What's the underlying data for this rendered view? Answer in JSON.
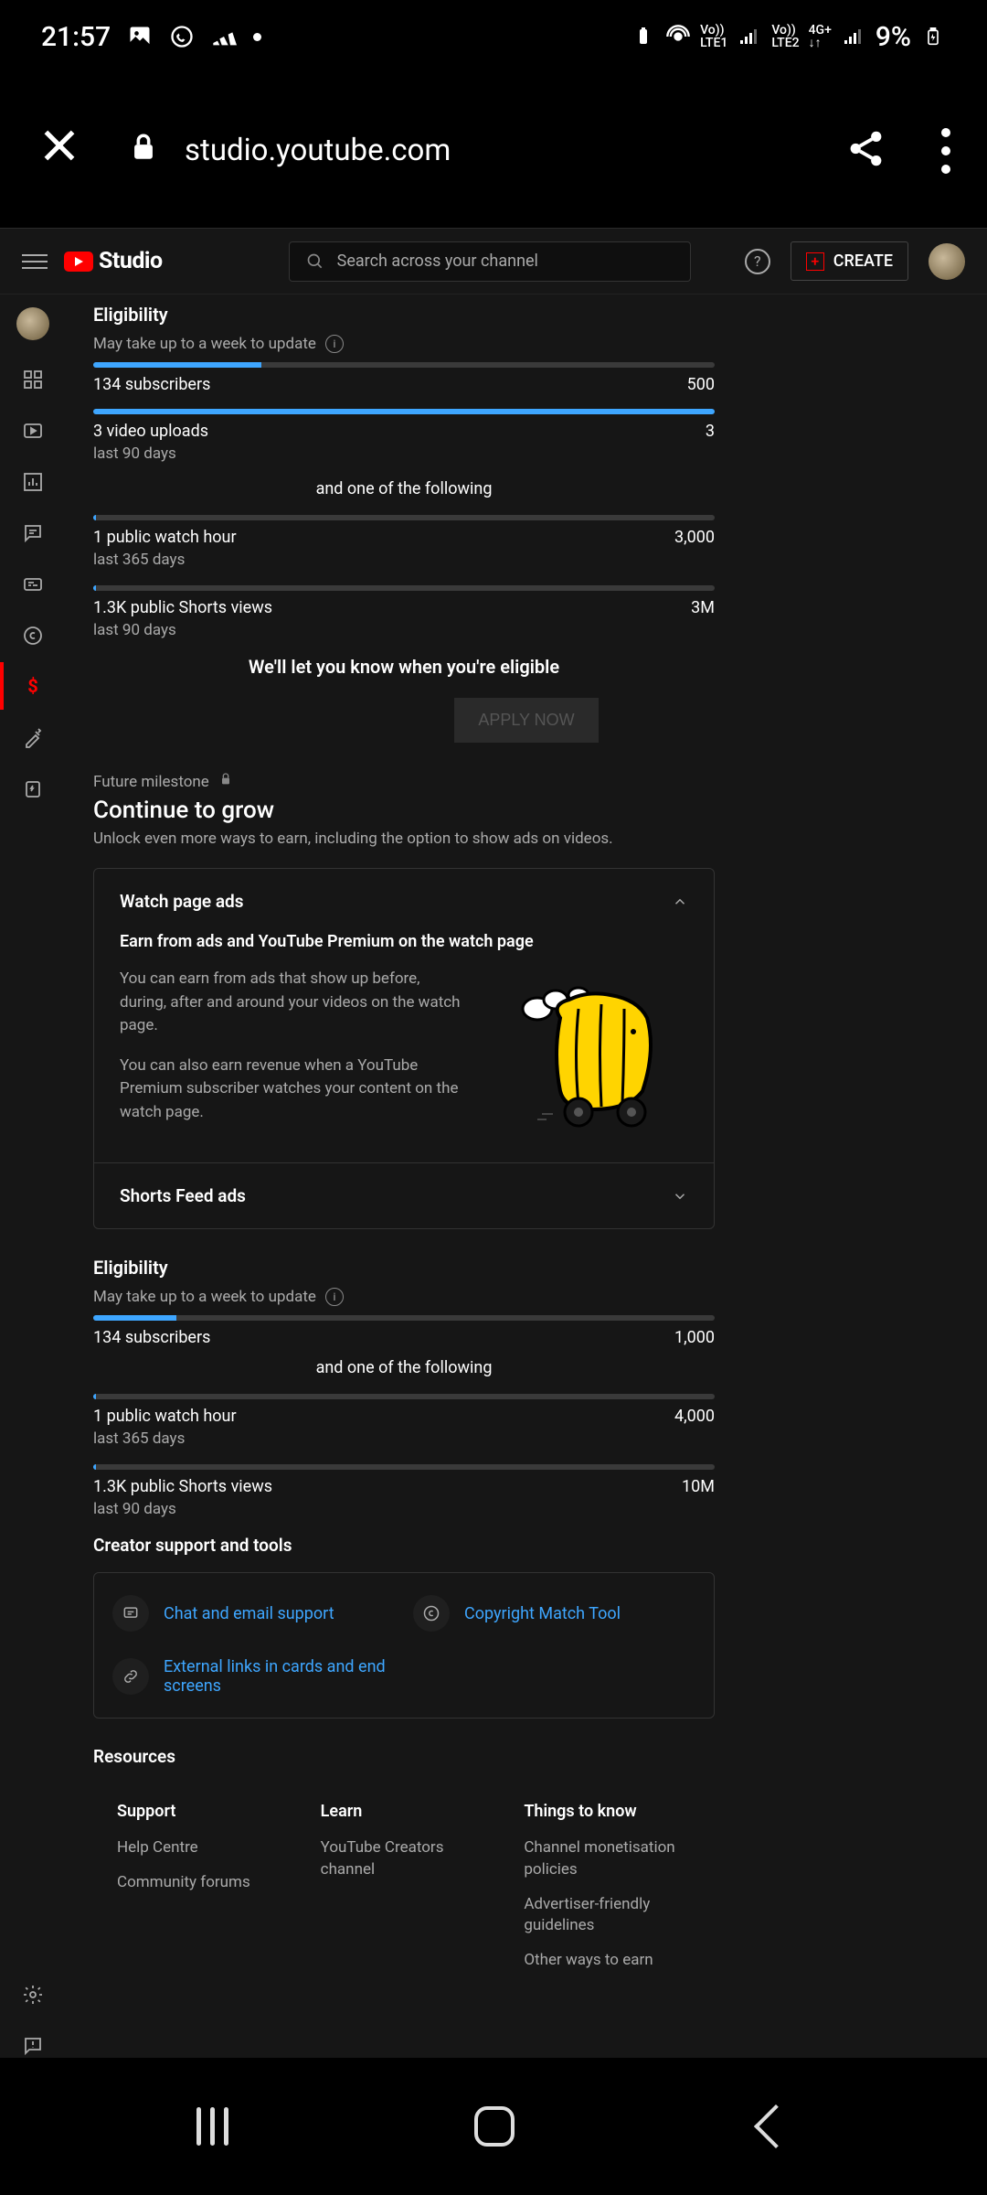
{
  "status": {
    "time": "21:57",
    "battery": "9%",
    "lte1": "LTE1",
    "lte2": "LTE2",
    "net": "4G+",
    "vo": "Vo))"
  },
  "browser": {
    "url": "studio.youtube.com"
  },
  "header": {
    "studio": "Studio",
    "search_placeholder": "Search across your channel",
    "create": "CREATE"
  },
  "eligibility1": {
    "title": "Eligibility",
    "note": "May take up to a week to update",
    "m1_label": "134 subscribers",
    "m1_target": "500",
    "m2_label": "3 video uploads",
    "m2_sub": "last 90 days",
    "m2_target": "3",
    "divider": "and one of the following",
    "m3_label": "1 public watch hour",
    "m3_sub": "last 365 days",
    "m3_target": "3,000",
    "m4_label": "1.3K public Shorts views",
    "m4_sub": "last 90 days",
    "m4_target": "3M",
    "msg": "We'll let you know when you're eligible",
    "apply": "APPLY NOW"
  },
  "grow": {
    "milestone": "Future milestone",
    "title": "Continue to grow",
    "sub": "Unlock even more ways to earn, including the option to show ads on videos.",
    "card1_title": "Watch page ads",
    "card1_subtitle": "Earn from ads and YouTube Premium on the watch page",
    "card1_p1": "You can earn from ads that show up before, during, after and around your videos on the watch page.",
    "card1_p2": "You can also earn revenue when a YouTube Premium subscriber watches your content on the watch page.",
    "card2_title": "Shorts Feed ads"
  },
  "eligibility2": {
    "title": "Eligibility",
    "note": "May take up to a week to update",
    "m1_label": "134 subscribers",
    "m1_target": "1,000",
    "divider": "and one of the following",
    "m2_label": "1 public watch hour",
    "m2_sub": "last 365 days",
    "m2_target": "4,000",
    "m3_label": "1.3K public Shorts views",
    "m3_sub": "last 90 days",
    "m3_target": "10M"
  },
  "tools": {
    "title": "Creator support and tools",
    "t1": "Chat and email support",
    "t2": "Copyright Match Tool",
    "t3": "External links in cards and end screens"
  },
  "resources": {
    "title": "Resources",
    "col1_h": "Support",
    "col1_a": "Help Centre",
    "col1_b": "Community forums",
    "col2_h": "Learn",
    "col2_a": "YouTube Creators channel",
    "col3_h": "Things to know",
    "col3_a": "Channel monetisation policies",
    "col3_b": "Advertiser-friendly guidelines",
    "col3_c": "Other ways to earn"
  }
}
